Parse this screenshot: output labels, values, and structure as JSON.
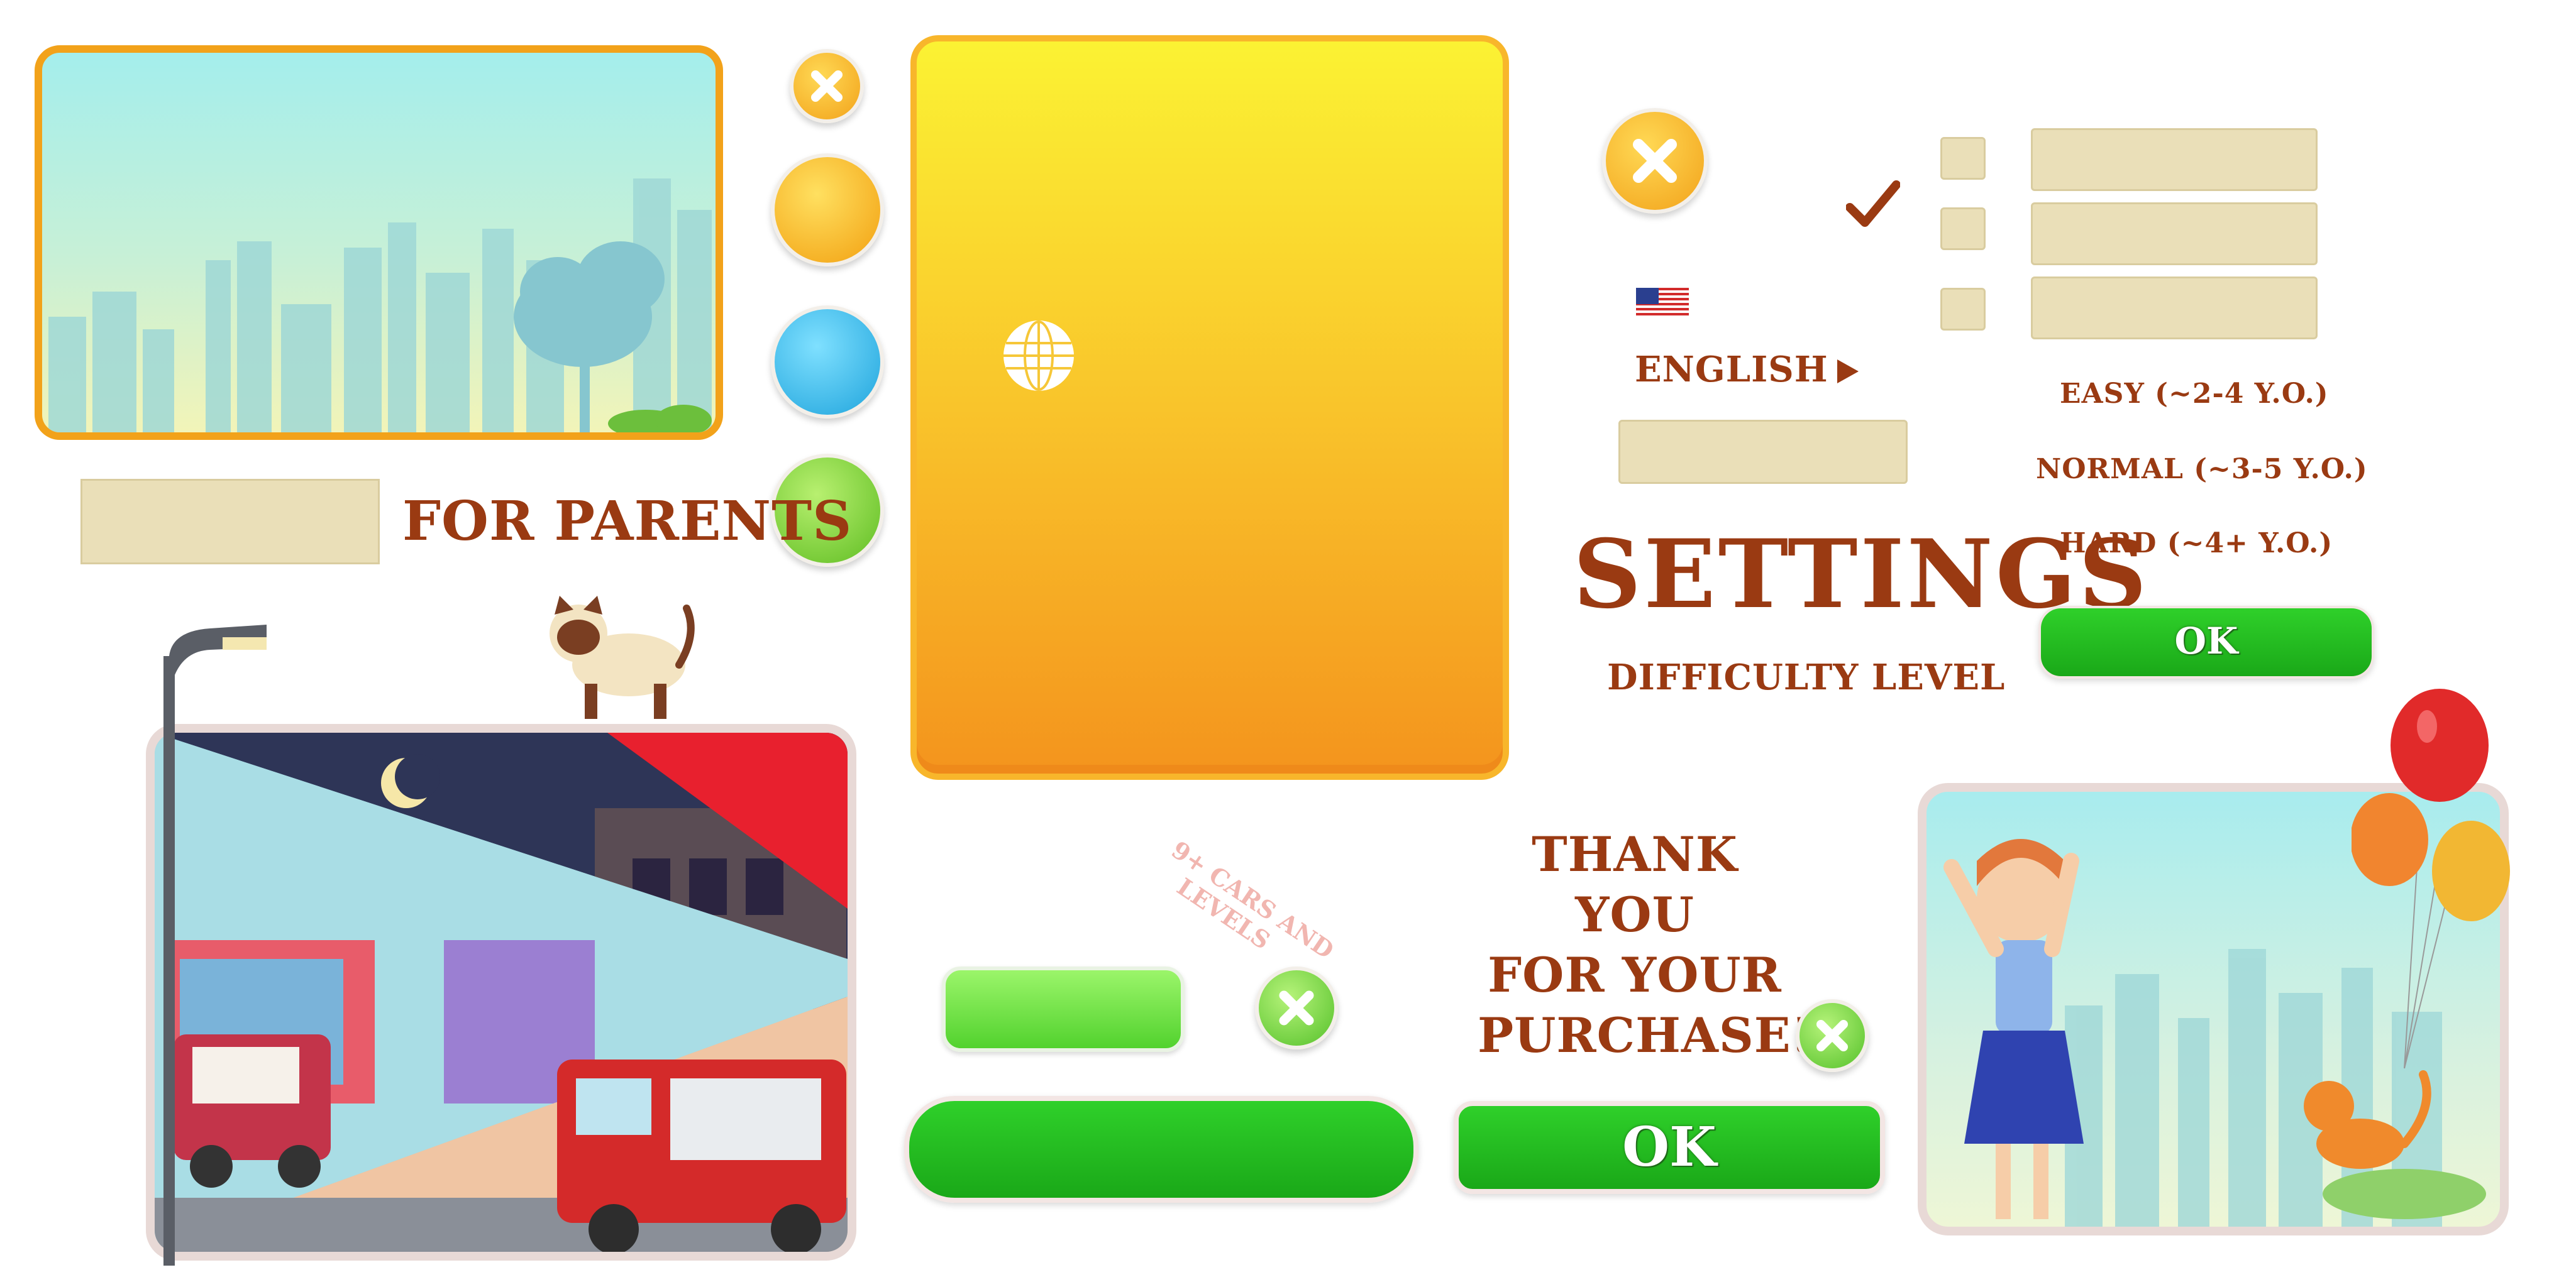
{
  "labels": {
    "for_parents": "FOR PARENTS",
    "settings": "SETTINGS",
    "difficulty_level": "DIFFICULTY LEVEL",
    "language": "ENGLISH",
    "easy": "EASY (~2-4 Y.O.)",
    "normal": "NORMAL (~3-5 Y.O.)",
    "hard": "HARD (~4+ Y.O.)",
    "ok_settings": "OK",
    "ok_main": "OK",
    "badge_line1": "9+ CARS AND",
    "badge_line2": "LEVELS",
    "thanks_line1": "THANK YOU",
    "thanks_line2": "FOR YOUR",
    "thanks_line3": "PURCHASE!"
  },
  "icons": {
    "close": "close-icon",
    "globe": "globe-icon",
    "flag": "us-flag-icon",
    "arrow": "play-arrow-icon",
    "check": "checkmark-icon"
  },
  "colors": {
    "orange_border": "#f2a21a",
    "text_brown": "#9a3a12",
    "green": "#1fb81c",
    "blue": "#33b8e8",
    "yellow": "#f9c42b",
    "lime": "#7ad43c"
  }
}
